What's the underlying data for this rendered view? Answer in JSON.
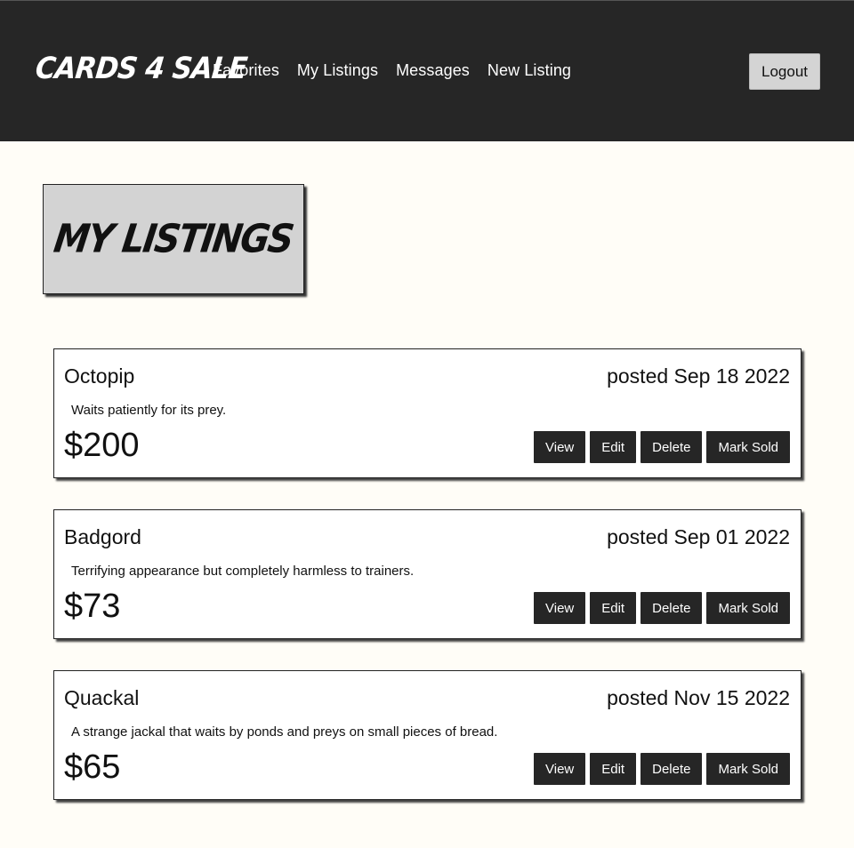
{
  "header": {
    "brand": "CARDS 4 SALE",
    "nav": [
      "Favorites",
      "My Listings",
      "Messages",
      "New Listing"
    ],
    "logout_label": "Logout"
  },
  "page": {
    "title": "MY LISTINGS"
  },
  "actions": {
    "view": "View",
    "edit": "Edit",
    "delete": "Delete",
    "mark_sold": "Mark Sold"
  },
  "listings": [
    {
      "name": "Octopip",
      "date": "posted Sep 18 2022",
      "description": "Waits patiently for its prey.",
      "price": "$200"
    },
    {
      "name": "Badgord",
      "date": "posted Sep 01 2022",
      "description": "Terrifying appearance but completely harmless to trainers.",
      "price": "$73"
    },
    {
      "name": "Quackal",
      "date": "posted Nov 15 2022",
      "description": "A strange jackal that waits by ponds and preys on small pieces of bread.",
      "price": "$65"
    }
  ],
  "colors": {
    "navbar_bg": "#262626",
    "page_bg": "#fffdf7",
    "button_bg": "#262626",
    "logout_bg": "#d4d4d4",
    "heading_box_bg": "#d3d3d3"
  }
}
